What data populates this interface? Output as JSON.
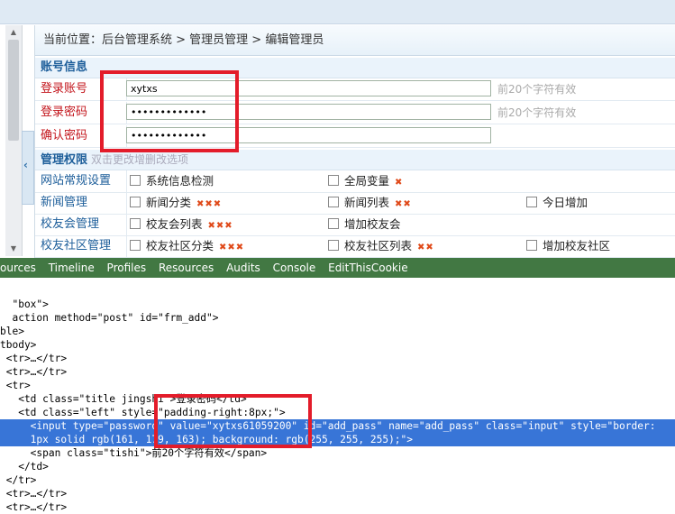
{
  "breadcrumb": "当前位置：后台管理系统 > 管理员管理 > 编辑管理员",
  "account_section": {
    "title": "账号信息"
  },
  "fields": [
    {
      "label": "登录账号",
      "value": "xytxs",
      "tip": "前20个字符有效"
    },
    {
      "label": "登录密码",
      "value": "•••••••••••••",
      "tip": "前20个字符有效"
    },
    {
      "label": "确认密码",
      "value": "•••••••••••••",
      "tip": ""
    }
  ],
  "perm_section": {
    "title": "管理权限",
    "hint": "双击更改增删改选项"
  },
  "perm_rows": [
    {
      "label": "网站常规设置",
      "options": [
        {
          "text": "系统信息检测",
          "marks": ""
        },
        {
          "text": "全局变量",
          "marks": "✖"
        }
      ]
    },
    {
      "label": "新闻管理",
      "options": [
        {
          "text": "新闻分类",
          "marks": "✖✖✖"
        },
        {
          "text": "新闻列表",
          "marks": "✖✖"
        },
        {
          "text": "今日增加",
          "marks": ""
        }
      ]
    },
    {
      "label": "校友会管理",
      "options": [
        {
          "text": "校友会列表",
          "marks": "✖✖✖"
        },
        {
          "text": "增加校友会",
          "marks": ""
        }
      ]
    },
    {
      "label": "校友社区管理",
      "options": [
        {
          "text": "校友社区分类",
          "marks": "✖✖✖"
        },
        {
          "text": "校友社区列表",
          "marks": "✖✖"
        },
        {
          "text": "增加校友社区",
          "marks": ""
        }
      ]
    }
  ],
  "devtools_tabs": [
    "ources",
    "Timeline",
    "Profiles",
    "Resources",
    "Audits",
    "Console",
    "EditThisCookie"
  ],
  "code_lines": [
    "  \"box\">",
    "  action method=\"post\" id=\"frm_add\">",
    "ble>",
    "tbody>",
    " <tr>…</tr>",
    " <tr>…</tr>",
    " <tr>",
    "   <td class=\"title jingshi\">登录密码</td>",
    "   <td class=\"left\" style=\"padding-right:8px;\">",
    "     <input type=\"password\" value=\"xytxs61059200\" id=\"add_pass\" name=\"add_pass\" class=\"input\" style=\"border:",
    "     1px solid rgb(161, 179, 163); background: rgb(255, 255, 255);\">",
    "     <span class=\"tishi\">前20个字符有效</span>",
    "   </td>",
    " </tr>",
    " <tr>…</tr>",
    " <tr>…</tr>"
  ]
}
